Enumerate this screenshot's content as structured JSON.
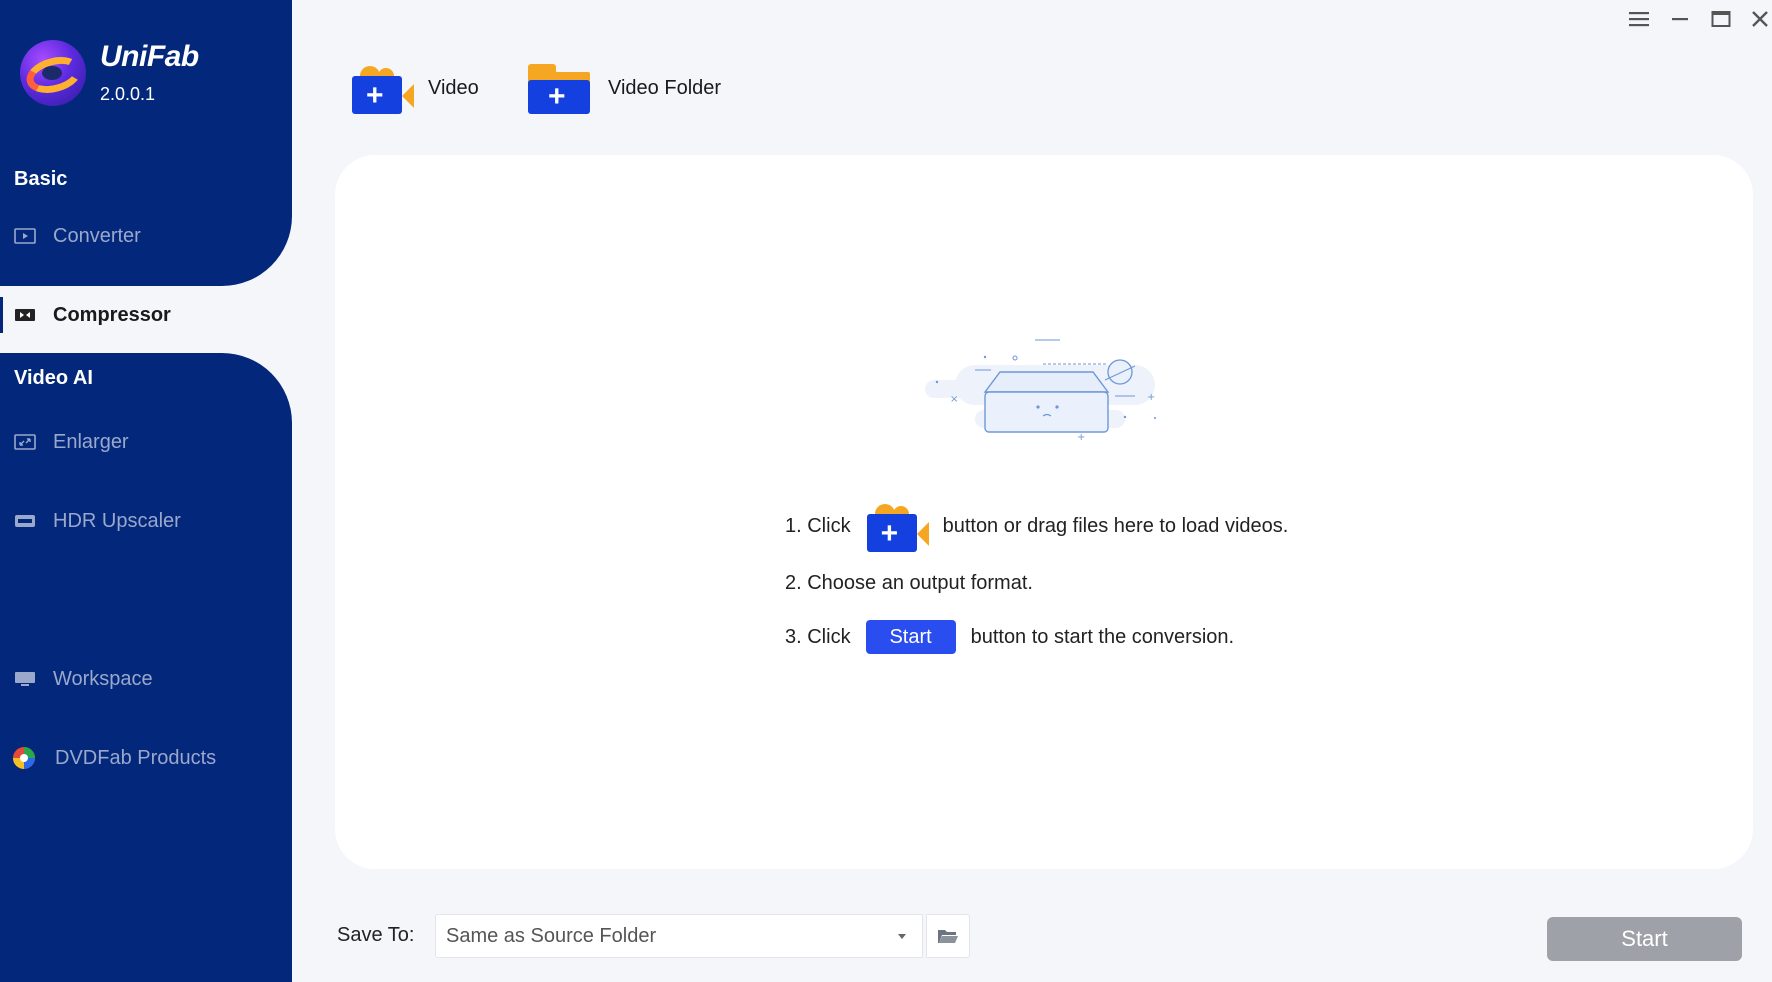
{
  "app": {
    "name": "UniFab",
    "version": "2.0.0.1"
  },
  "sidebar": {
    "sections": {
      "basic": "Basic",
      "video_ai": "Video AI"
    },
    "items": [
      {
        "label": "Converter",
        "icon": "play-box-icon"
      },
      {
        "label": "Compressor",
        "icon": "compress-icon",
        "active": true
      },
      {
        "label": "Enlarger",
        "icon": "enlarge-icon"
      },
      {
        "label": "HDR Upscaler",
        "icon": "hdr-icon"
      },
      {
        "label": "Workspace",
        "icon": "monitor-icon"
      },
      {
        "label": "DVDFab Products",
        "icon": "dvdfab-logo-icon"
      }
    ]
  },
  "toolbar": {
    "add_video": "Video",
    "add_folder": "Video Folder"
  },
  "window_controls": [
    "menu-icon",
    "minimize-icon",
    "maximize-icon",
    "close-icon"
  ],
  "instructions": {
    "step1_prefix": "1. Click",
    "step1_suffix": "button or drag files here to load videos.",
    "step2": "2. Choose an output format.",
    "step3_prefix": "3. Click",
    "step3_button": "Start",
    "step3_suffix": "button to start the conversion."
  },
  "bottom": {
    "save_to_label": "Save To:",
    "save_to_value": "Same as Source Folder",
    "start_label": "Start"
  },
  "colors": {
    "sidebar": "#03277a",
    "accent": "#2a4df0",
    "orange": "#f5a623",
    "start_disabled": "#9ea1a8"
  }
}
